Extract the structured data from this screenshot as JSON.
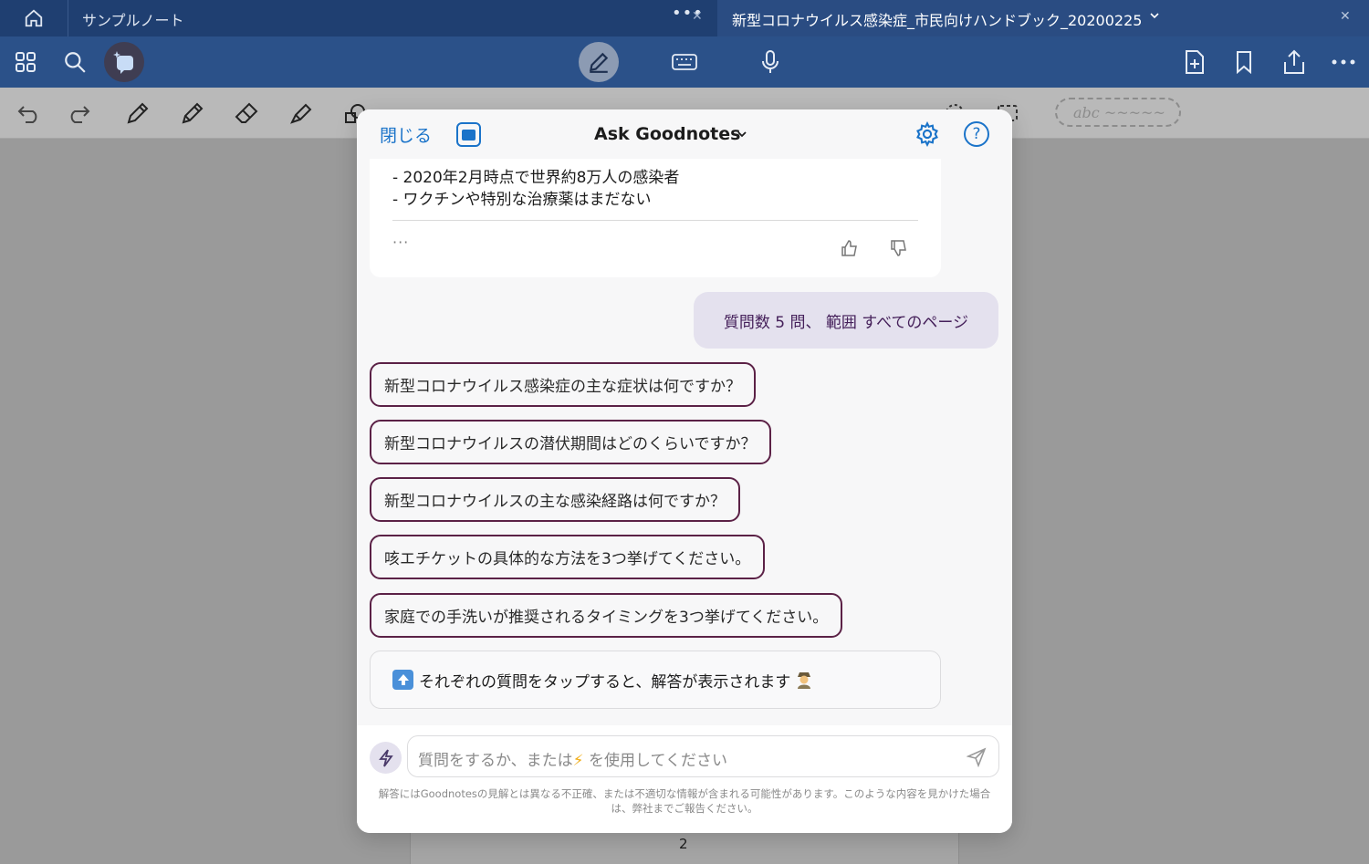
{
  "tabs": {
    "left_label": "サンプルノート",
    "active_label": "新型コロナウイルス感染症_市民向けハンドブック_20200225"
  },
  "page": {
    "number": "2"
  },
  "tools_row": {
    "text_chip": "abc ~~~~~"
  },
  "modal": {
    "close_label": "閉じる",
    "title": "Ask Goodnotes",
    "help_label": "?",
    "answer": {
      "line1": "- 2020年2月時点で世界約8万人の感染者",
      "line2": "- ワクチンや特別な治療薬はまだない",
      "more": "···"
    },
    "user_message": "質問数 5 問、 範囲 すべてのページ",
    "questions": [
      "新型コロナウイルス感染症の主な症状は何ですか？",
      "新型コロナウイルスの潜伏期間はどのくらいですか？",
      "新型コロナウイルスの主な感染経路は何ですか？",
      "咳エチケットの具体的な方法を3つ挙げてください。",
      "家庭での手洗いが推奨されるタイミングを3つ挙げてください。"
    ],
    "info": "それぞれの質問をタップすると、解答が表示されます",
    "input": {
      "placeholder_before": "質問をするか、または",
      "placeholder_after": " を使用してください"
    },
    "disclaimer": "解答にはGoodnotesの見解とは異なる不正確、または不適切な情報が含まれる可能性があります。このような内容を見かけた場合は、弊社までご報告ください。"
  },
  "colors": {
    "tab_bar": "#1f3f71",
    "toolbar": "#2b5189",
    "accent_blue": "#1a73c9",
    "chip_border": "#5b2146",
    "user_bubble": "#e4e1ee"
  }
}
